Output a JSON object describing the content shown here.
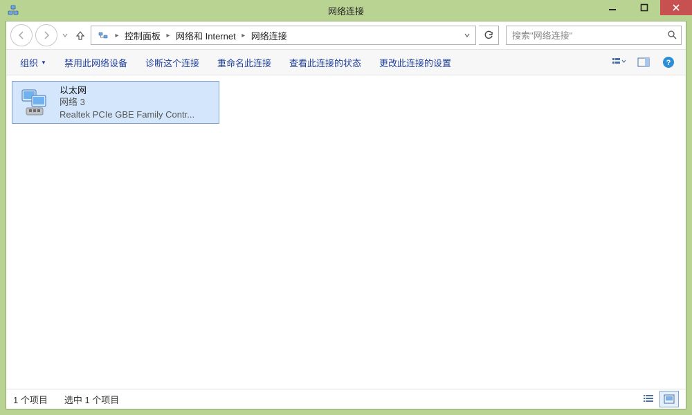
{
  "window": {
    "title": "网络连接"
  },
  "address": {
    "crumbs": [
      "控制面板",
      "网络和 Internet",
      "网络连接"
    ]
  },
  "search": {
    "placeholder": "搜索\"网络连接\""
  },
  "toolbar": {
    "organize": "组织",
    "disable": "禁用此网络设备",
    "diagnose": "诊断这个连接",
    "rename": "重命名此连接",
    "status": "查看此连接的状态",
    "change": "更改此连接的设置"
  },
  "connections": [
    {
      "name": "以太网",
      "subtitle": "网络  3",
      "device": "Realtek PCIe GBE Family Contr..."
    }
  ],
  "statusbar": {
    "count": "1 个项目",
    "selected": "选中 1 个项目"
  }
}
